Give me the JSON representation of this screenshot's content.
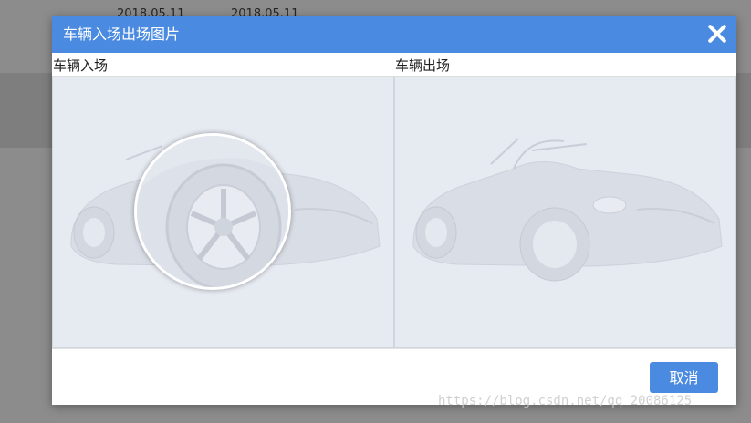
{
  "background": {
    "dates": [
      "2018.05.11",
      "2018.05.11"
    ]
  },
  "modal": {
    "title": "车辆入场出场图片",
    "left_label": "车辆入场",
    "right_label": "车辆出场",
    "cancel_label": "取消"
  },
  "watermark": "https://blog.csdn.net/qq_20086125",
  "colors": {
    "header": "#4a8ae0",
    "button": "#4a8ae0",
    "panel_bg": "#e6eaf1"
  },
  "icons": {
    "close": "close-icon",
    "magnifier": "magnifier-lens",
    "car": "car-image"
  }
}
